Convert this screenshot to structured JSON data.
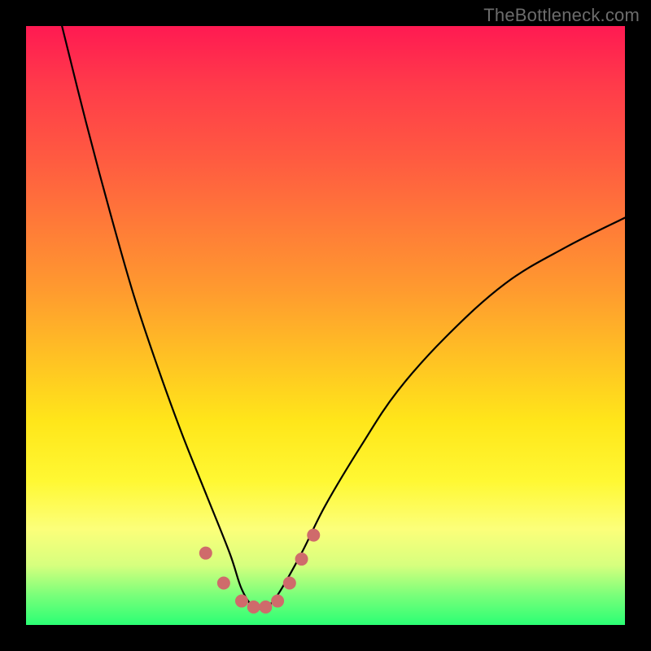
{
  "attribution": "TheBottleneck.com",
  "chart_data": {
    "type": "line",
    "title": "",
    "xlabel": "",
    "ylabel": "",
    "xlim": [
      0,
      100
    ],
    "ylim": [
      0,
      100
    ],
    "grid": false,
    "legend": false,
    "description": "V-shaped curve over a vertical red-to-green gradient (bottleneck-style visualization). Minimum near x≈36–40, y≈3. Left branch rises to top-left corner; right branch rises toward upper-right.",
    "series": [
      {
        "name": "curve",
        "color": "#000000",
        "x": [
          6,
          10,
          14,
          18,
          22,
          26,
          30,
          34,
          36,
          38,
          40,
          42,
          46,
          50,
          56,
          62,
          70,
          80,
          90,
          100
        ],
        "y": [
          100,
          84,
          69,
          55,
          43,
          32,
          22,
          12,
          6,
          3,
          3,
          5,
          12,
          20,
          30,
          39,
          48,
          57,
          63,
          68
        ]
      }
    ],
    "markers": {
      "name": "highlight-dots",
      "color": "#cf6b6b",
      "radius_px": 8,
      "points": [
        {
          "x": 30,
          "y": 12
        },
        {
          "x": 33,
          "y": 7
        },
        {
          "x": 36,
          "y": 4
        },
        {
          "x": 38,
          "y": 3
        },
        {
          "x": 40,
          "y": 3
        },
        {
          "x": 42,
          "y": 4
        },
        {
          "x": 44,
          "y": 7
        },
        {
          "x": 46,
          "y": 11
        },
        {
          "x": 48,
          "y": 15
        }
      ]
    },
    "gradient_stops": [
      {
        "pos": 0.0,
        "color": "#ff1a52"
      },
      {
        "pos": 0.1,
        "color": "#ff3b4a"
      },
      {
        "pos": 0.22,
        "color": "#ff5a41"
      },
      {
        "pos": 0.33,
        "color": "#ff7a38"
      },
      {
        "pos": 0.44,
        "color": "#ff9a2f"
      },
      {
        "pos": 0.55,
        "color": "#ffc024"
      },
      {
        "pos": 0.66,
        "color": "#ffe61a"
      },
      {
        "pos": 0.76,
        "color": "#fff833"
      },
      {
        "pos": 0.84,
        "color": "#fcff7a"
      },
      {
        "pos": 0.9,
        "color": "#d7ff7e"
      },
      {
        "pos": 0.95,
        "color": "#7aff7a"
      },
      {
        "pos": 1.0,
        "color": "#2bff74"
      }
    ]
  }
}
